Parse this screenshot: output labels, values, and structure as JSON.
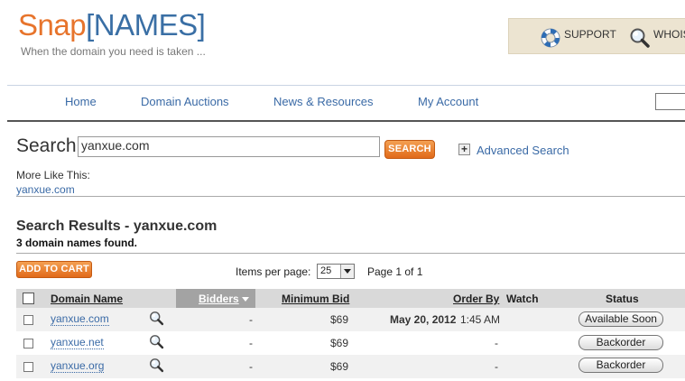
{
  "brand": {
    "logo_snap": "Snap",
    "logo_names": "[NAMES]",
    "tagline": "When the domain you need is taken ..."
  },
  "utility": {
    "support": "SUPPORT",
    "whois": "WHOIS"
  },
  "nav": {
    "items": [
      "Home",
      "Domain Auctions",
      "News & Resources",
      "My Account"
    ]
  },
  "search": {
    "label": "Search",
    "value": "yanxue.com",
    "button": "SEARCH",
    "advanced": "Advanced Search"
  },
  "more_like": {
    "label": "More Like This:",
    "link": "yanxue.com"
  },
  "results": {
    "title": "Search Results - yanxue.com",
    "count": "3 domain names found.",
    "add_to_cart": "ADD TO CART",
    "items_per_page_label": "Items per page:",
    "items_per_page": "25",
    "page_info": "Page 1 of 1",
    "columns": {
      "domain": "Domain Name",
      "bidders": "Bidders",
      "min_bid": "Minimum Bid",
      "order_by": "Order By",
      "watch": "Watch",
      "status": "Status"
    },
    "rows": [
      {
        "domain": "yanxue.com",
        "bidders": "-",
        "min_bid": "$69",
        "order_date": "May 20, 2012",
        "order_time": "1:45 AM",
        "status": "Available Soon"
      },
      {
        "domain": "yanxue.net",
        "bidders": "-",
        "min_bid": "$69",
        "order_date": "",
        "order_time": "-",
        "status": "Backorder"
      },
      {
        "domain": "yanxue.org",
        "bidders": "-",
        "min_bid": "$69",
        "order_date": "",
        "order_time": "-",
        "status": "Backorder"
      }
    ]
  },
  "colors": {
    "brand_orange": "#e7742c",
    "brand_blue": "#3a6fa5",
    "link_blue": "#3a6aa6",
    "utility_bg": "#ece4d1"
  },
  "icons": [
    "lifebuoy-icon",
    "magnifier-icon",
    "plus-icon",
    "dropdown-arrow-icon",
    "sort-desc-icon"
  ]
}
